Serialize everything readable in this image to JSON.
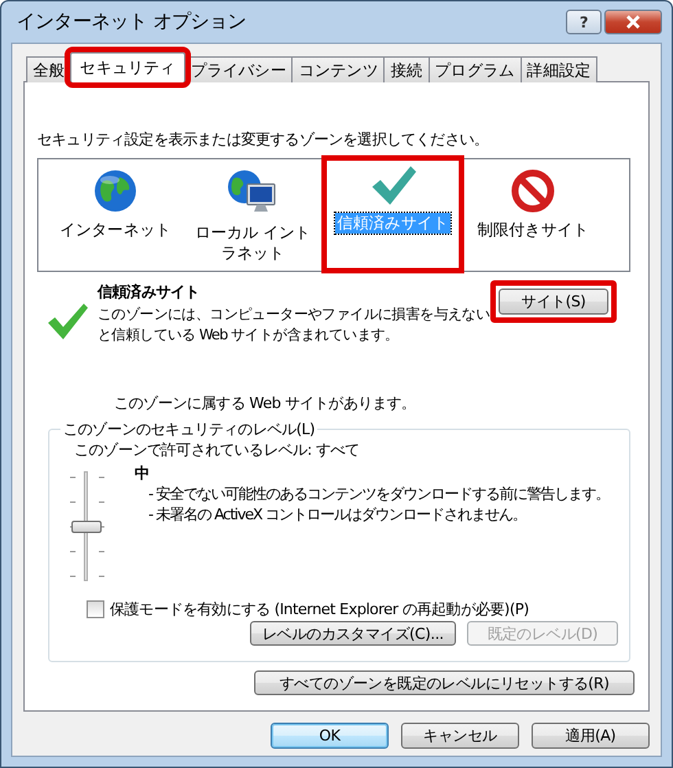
{
  "window": {
    "title": "インターネット オプション",
    "help_button": "?"
  },
  "tabs": [
    {
      "label": "全般",
      "selected": false,
      "highlighted": false
    },
    {
      "label": "セキュリティ",
      "selected": true,
      "highlighted": true
    },
    {
      "label": "プライバシー",
      "selected": false,
      "highlighted": false
    },
    {
      "label": "コンテンツ",
      "selected": false,
      "highlighted": false
    },
    {
      "label": "接続",
      "selected": false,
      "highlighted": false
    },
    {
      "label": "プログラム",
      "selected": false,
      "highlighted": false
    },
    {
      "label": "詳細設定",
      "selected": false,
      "highlighted": false
    }
  ],
  "instruction": "セキュリティ設定を表示または変更するゾーンを選択してください。",
  "zones": [
    {
      "label": "インターネット",
      "kind": "globe",
      "selected": false,
      "highlighted": false
    },
    {
      "label": "ローカル イントラネット",
      "kind": "intranet",
      "selected": false,
      "highlighted": false
    },
    {
      "label": "信頼済みサイト",
      "kind": "check",
      "selected": true,
      "highlighted": true
    },
    {
      "label": "制限付きサイト",
      "kind": "forbidden",
      "selected": false,
      "highlighted": false
    }
  ],
  "zone_info": {
    "title": "信頼済みサイト",
    "lines": [
      "このゾーンには、コンピューターやファイルに損害を与えない",
      "と信頼している Web サイトが含まれています。"
    ],
    "sites_button": {
      "label": "サイト(S)",
      "highlighted": true
    },
    "note": "このゾーンに属する Web サイトがあります。"
  },
  "level_group": {
    "legend": "このゾーンのセキュリティのレベル(L)",
    "allowed": "このゾーンで許可されているレベル: すべて",
    "slider": {
      "level": 0.5
    },
    "level_name": "中",
    "details": [
      "- 安全でない可能性のあるコンテンツをダウンロードする前に警告します。",
      "- 未署名の ActiveX コントロールはダウンロードされません。"
    ],
    "protected_mode": {
      "label": "保護モードを有効にする (Internet Explorer の再起動が必要)(P)",
      "checked": false
    },
    "buttons": [
      {
        "label": "レベルのカスタマイズ(C)...",
        "disabled": false
      },
      {
        "label": "既定のレベル(D)",
        "disabled": true
      }
    ]
  },
  "reset_button": "すべてのゾーンを既定のレベルにリセットする(R)",
  "footer_buttons": [
    {
      "label": "OK",
      "default": true
    },
    {
      "label": "キャンセル",
      "default": false
    },
    {
      "label": "適用(A)",
      "default": false
    }
  ]
}
